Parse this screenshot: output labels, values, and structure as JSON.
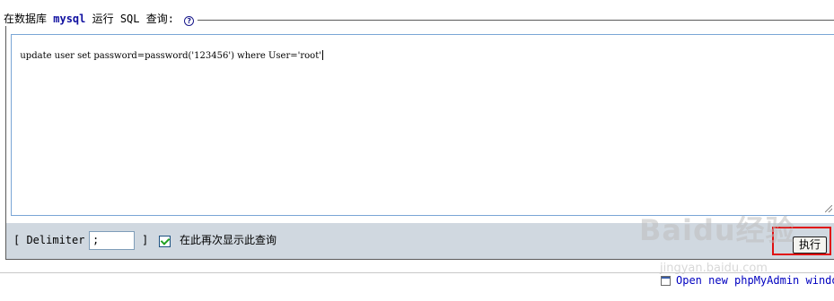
{
  "query_box": {
    "legend_prefix": "在数据库",
    "database": "mysql",
    "legend_suffix": "运行 SQL 查询:",
    "help_icon": "question-mark-icon"
  },
  "sql": {
    "text": "update user set password=password('123456') where User='root'"
  },
  "toolbar": {
    "delimiter_open": "[ Delimiter",
    "delimiter_value": ";",
    "delimiter_close": "]",
    "show_again_checked": true,
    "show_again_label": "在此再次显示此查询",
    "execute_label": "执行"
  },
  "watermark": {
    "text": "Baidu经验",
    "sub": "jingyan.baidu.com"
  },
  "footer": {
    "open_window_link": "Open new phpMyAdmin windo",
    "window_icon": "new-window-icon"
  },
  "colors": {
    "toolbar_bg": "#d0d8e0",
    "highlight_border": "#e01010",
    "link": "#0000c0",
    "db_name": "#1010a0"
  }
}
